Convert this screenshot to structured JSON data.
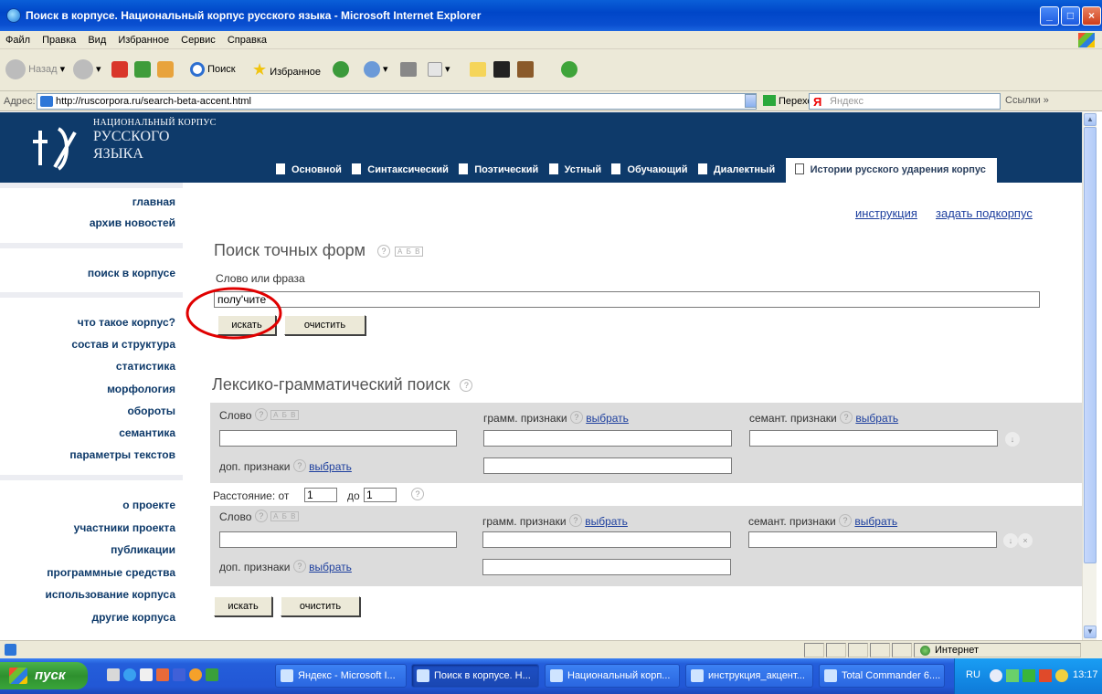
{
  "window": {
    "title": "Поиск в корпусе. Национальный корпус русского языка - Microsoft Internet Explorer"
  },
  "menu": [
    "Файл",
    "Правка",
    "Вид",
    "Избранное",
    "Сервис",
    "Справка"
  ],
  "toolbar": {
    "back": "Назад",
    "search": "Поиск",
    "favorites": "Избранное"
  },
  "address": {
    "label": "Адрес:",
    "url": "http://ruscorpora.ru/search-beta-accent.html",
    "go": "Переход",
    "yandex_placeholder": "Яндекс",
    "yandex_logo": "Я",
    "links": "Ссылки"
  },
  "site": {
    "logo": {
      "line1": "НАЦИОНАЛЬНЫЙ КОРПУС",
      "line2": "РУССКОГО",
      "line3": "ЯЗЫКА"
    },
    "tabs": [
      "Основной",
      "Синтаксический",
      "Поэтический",
      "Устный",
      "Обучающий",
      "Диалектный"
    ],
    "active_tab": "Истории русского ударения корпус"
  },
  "nav": {
    "group1": [
      "главная",
      "архив новостей"
    ],
    "group2": [
      "поиск в корпусе"
    ],
    "group3": [
      "что такое корпус?",
      "состав и структура",
      "статистика",
      "морфология",
      "обороты",
      "семантика",
      "параметры текстов"
    ],
    "group4": [
      "о проекте",
      "участники проекта",
      "публикации",
      "программные средства",
      "использование корпуса",
      "другие корпуса"
    ]
  },
  "content": {
    "top_links": {
      "instruction": "инструкция",
      "subcorpus": "задать подкорпус"
    },
    "exact": {
      "title": "Поиск точных форм",
      "help": "?",
      "keyboard": "А Б В",
      "label": "Слово или фраза",
      "value": "полу'чите'",
      "search": "искать",
      "clear": "очистить"
    },
    "lexgram": {
      "title": "Лексико-грамматический поиск",
      "help": "?",
      "word": "Слово",
      "keyboard": "А Б В",
      "gram": "грамм. признаки",
      "sem": "семант. признаки",
      "choose": "выбрать",
      "extra": "доп. признаки",
      "distance": "Расстояние: от",
      "to": "до",
      "from_value": "1",
      "to_value": "1",
      "search": "искать",
      "clear": "очистить"
    }
  },
  "status": {
    "zone": "Интернет"
  },
  "taskbar": {
    "start": "пуск",
    "tasks": [
      "Яндекс - Microsoft I...",
      "Поиск в корпусе. Н...",
      "Национальный корп...",
      "инструкция_акцент...",
      "Total Commander 6...."
    ],
    "lang": "RU",
    "clock": "13:17"
  },
  "colors": {
    "header": "#0e3a6a",
    "link": "#1d3f9e",
    "panel": "#dcdcdc",
    "annotation": "#e00000"
  }
}
